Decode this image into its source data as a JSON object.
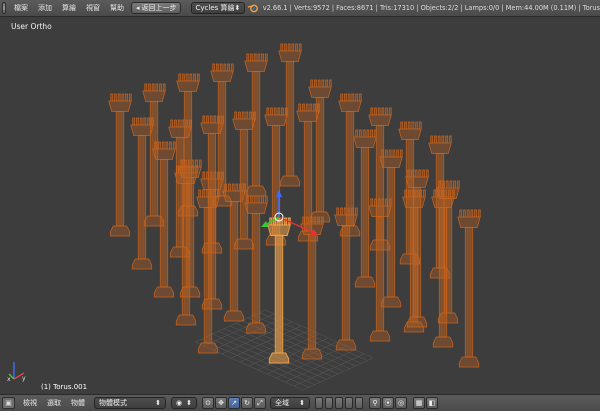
{
  "header": {
    "menus": [
      "檔案",
      "添加",
      "算繪",
      "視窗",
      "幫助"
    ],
    "back_button": "返回上一步",
    "render_engine": "Cycles 算繪",
    "stats": "v2.66.1 | Verts:9572 | Faces:8671 | Tris:17310 | Objects:2/2 | Lamps:0/0 | Mem:44.00M (0.11M) | Torus"
  },
  "viewport": {
    "view_label": "User Ortho",
    "object_label": "(1) Torus.001",
    "colors": {
      "background": "#3d3d3d",
      "wire": "#c8641e",
      "selected": "#f0a248",
      "grid": "#555555"
    }
  },
  "footer": {
    "menus": [
      "檢視",
      "選取",
      "物體"
    ],
    "mode": "物體模式",
    "pivot_space": "全域",
    "icons": [
      "cube-icon",
      "pivot-icon",
      "manipulator-icon",
      "translate-icon",
      "rotate-icon",
      "scale-icon",
      "layers-icon",
      "lock-icon",
      "render-icon",
      "camera-icon"
    ]
  }
}
